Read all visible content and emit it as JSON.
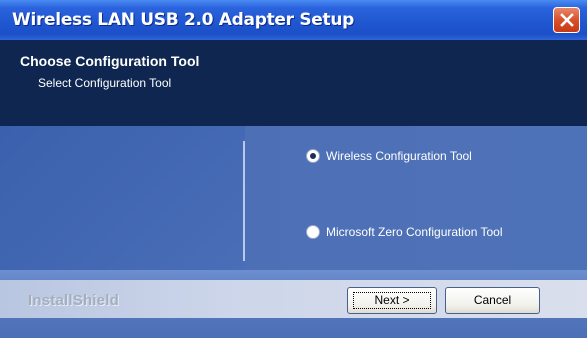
{
  "window": {
    "title": "Wireless LAN USB 2.0 Adapter Setup"
  },
  "header": {
    "title": "Choose Configuration Tool",
    "subtitle": "Select Configuration Tool"
  },
  "options": [
    {
      "label": "Wireless Configuration Tool",
      "selected": true
    },
    {
      "label": "Microsoft Zero Configuration Tool",
      "selected": false
    }
  ],
  "footer": {
    "brand": "InstallShield",
    "next_label": "Next >",
    "cancel_label": "Cancel"
  },
  "colors": {
    "title_bar": "#2358d6",
    "header_band": "#0f2750",
    "body_bg": "#4a6cb4",
    "close_button": "#d9502b"
  },
  "icons": {
    "close": "close-icon"
  }
}
